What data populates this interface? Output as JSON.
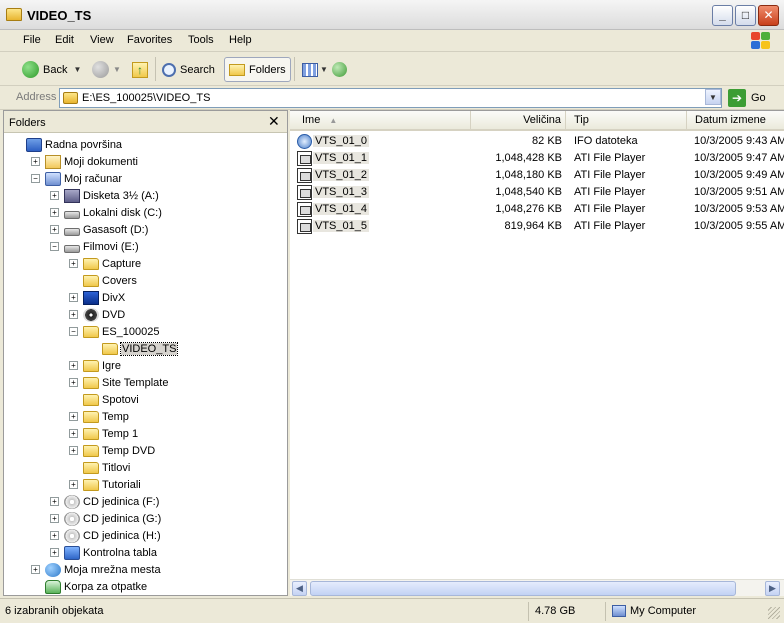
{
  "window": {
    "title": "VIDEO_TS"
  },
  "menu": [
    "File",
    "Edit",
    "View",
    "Favorites",
    "Tools",
    "Help"
  ],
  "toolbar": {
    "back": "Back",
    "search": "Search",
    "folders": "Folders"
  },
  "address": {
    "label": "Address",
    "value": "E:\\ES_100025\\VIDEO_TS",
    "go": "Go"
  },
  "folders_pane": {
    "title": "Folders",
    "tree": [
      {
        "label": "Radna površina",
        "icon": "desktop-icon"
      },
      {
        "label": "Moji dokumenti",
        "icon": "documents-icon"
      },
      {
        "label": "Moj računar",
        "icon": "computer-icon"
      },
      {
        "label": "Disketa 3½ (A:)",
        "icon": "floppy-icon"
      },
      {
        "label": "Lokalni disk (C:)",
        "icon": "drive-icon"
      },
      {
        "label": "Gasasoft (D:)",
        "icon": "drive-icon"
      },
      {
        "label": "Filmovi (E:)",
        "icon": "drive-icon"
      },
      {
        "label": "Capture",
        "icon": "folder-icon"
      },
      {
        "label": "Covers",
        "icon": "folder-icon"
      },
      {
        "label": "DivX",
        "icon": "divx-icon"
      },
      {
        "label": "DVD",
        "icon": "dvd-icon"
      },
      {
        "label": "ES_100025",
        "icon": "folder-icon"
      },
      {
        "label": "VIDEO_TS",
        "icon": "folder-open-icon"
      },
      {
        "label": "Igre",
        "icon": "folder-icon"
      },
      {
        "label": "Site Template",
        "icon": "folder-icon"
      },
      {
        "label": "Spotovi",
        "icon": "folder-icon"
      },
      {
        "label": "Temp",
        "icon": "folder-icon"
      },
      {
        "label": "Temp 1",
        "icon": "folder-icon"
      },
      {
        "label": "Temp DVD",
        "icon": "folder-icon"
      },
      {
        "label": "Titlovi",
        "icon": "folder-icon"
      },
      {
        "label": "Tutoriali",
        "icon": "folder-icon"
      },
      {
        "label": "CD jedinica (F:)",
        "icon": "cd-icon"
      },
      {
        "label": "CD jedinica (G:)",
        "icon": "cd-icon"
      },
      {
        "label": "CD jedinica (H:)",
        "icon": "cd-icon"
      },
      {
        "label": "Kontrolna tabla",
        "icon": "control-panel-icon"
      },
      {
        "label": "Moja mrežna mesta",
        "icon": "network-icon"
      },
      {
        "label": "Korpa za otpatke",
        "icon": "recycle-bin-icon"
      }
    ]
  },
  "file_list": {
    "columns": [
      "Ime",
      "Veličina",
      "Tip",
      "Datum izmene"
    ],
    "rows": [
      {
        "name": "VTS_01_0",
        "size": "82 KB",
        "type": "IFO datoteka",
        "date": "10/3/2005 9:43 AM"
      },
      {
        "name": "VTS_01_1",
        "size": "1,048,428 KB",
        "type": "ATI File Player",
        "date": "10/3/2005 9:47 AM"
      },
      {
        "name": "VTS_01_2",
        "size": "1,048,180 KB",
        "type": "ATI File Player",
        "date": "10/3/2005 9:49 AM"
      },
      {
        "name": "VTS_01_3",
        "size": "1,048,540 KB",
        "type": "ATI File Player",
        "date": "10/3/2005 9:51 AM"
      },
      {
        "name": "VTS_01_4",
        "size": "1,048,276 KB",
        "type": "ATI File Player",
        "date": "10/3/2005 9:53 AM"
      },
      {
        "name": "VTS_01_5",
        "size": "819,964 KB",
        "type": "ATI File Player",
        "date": "10/3/2005 9:55 AM"
      }
    ]
  },
  "status": {
    "selection": "6 izabranih objekata",
    "size": "4.78 GB",
    "location": "My Computer"
  }
}
